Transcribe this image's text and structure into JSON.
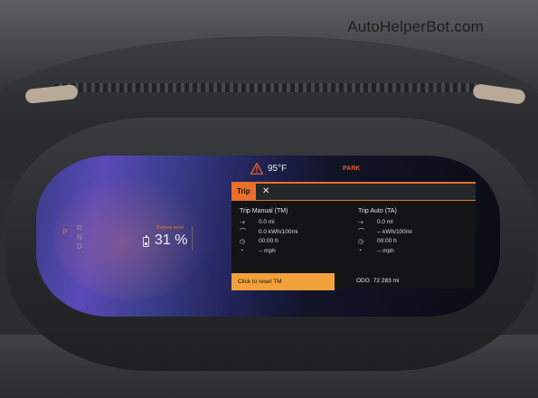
{
  "watermark": "AutoHelperBot.com",
  "status_bar": {
    "temperature": "95°F",
    "gear_state": "PARK",
    "warning_icon": "warning-triangle-icon"
  },
  "gear_selector": {
    "gears": [
      "P",
      "R",
      "N",
      "D"
    ],
    "active": "P"
  },
  "battery": {
    "label": "Battery level",
    "value": "31 %",
    "icon": "battery-icon"
  },
  "trip_panel": {
    "tab_label": "Trip",
    "close_symbol": "✕",
    "manual": {
      "title": "Trip Manual (TM)",
      "distance": "0.0 mi",
      "energy": "0.0 kWh/100mi",
      "time": "00:00 h",
      "speed": "-- mph"
    },
    "auto": {
      "title": "Trip Auto (TA)",
      "distance": "0.0 mi",
      "energy": "-- kWh/100mi",
      "time": "00:00 h",
      "speed": "-- mph"
    },
    "reset_button": "Click to reset TM",
    "odometer": {
      "label": "ODO",
      "value": "72 283 mi"
    }
  },
  "colors": {
    "accent": "#e8702a",
    "button": "#f2a23a",
    "panel_bg": "#141416"
  }
}
